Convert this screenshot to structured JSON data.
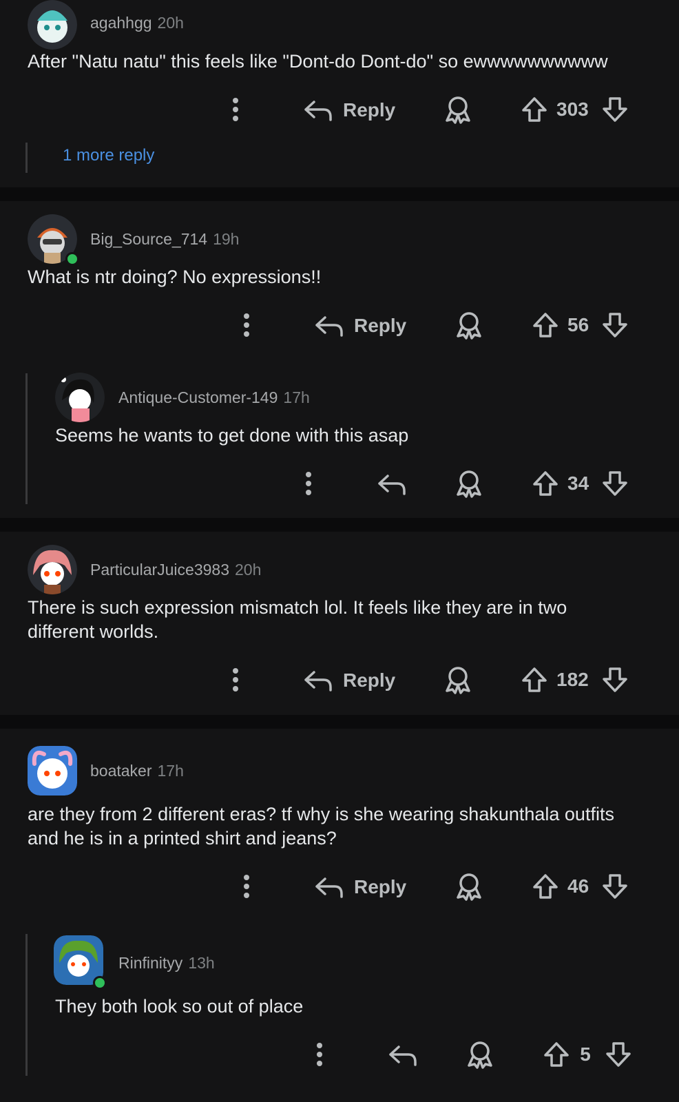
{
  "comments": [
    {
      "username": "agahhgg",
      "time": "20h",
      "text": "After \"Natu natu\" this feels like \"Dont-do Dont-do\" so ewwwwwwwwww",
      "reply_label": "Reply",
      "votes": "303",
      "more_replies": "1 more reply"
    },
    {
      "username": "Big_Source_714",
      "time": "19h",
      "text": "What is ntr doing? No expressions!!",
      "reply_label": "Reply",
      "votes": "56"
    },
    {
      "username": "Antique-Customer-149",
      "time": "17h",
      "text": "Seems he wants to get done with this asap",
      "votes": "34"
    },
    {
      "username": "ParticularJuice3983",
      "time": "20h",
      "text": "There is such expression mismatch lol. It feels like they are in two different worlds.",
      "reply_label": "Reply",
      "votes": "182"
    },
    {
      "username": "boataker",
      "time": "17h",
      "text": "are they from 2 different eras? tf why is she wearing shakunthala outfits and he is in a printed shirt and jeans?",
      "reply_label": "Reply",
      "votes": "46"
    },
    {
      "username": "Rinfinityy",
      "time": "13h",
      "text": "They both look so out of place",
      "votes": "5"
    }
  ],
  "colors": {
    "background": "#141415",
    "separator": "#0b0b0c",
    "link": "#4a90e2",
    "online": "#2fbf5a"
  }
}
